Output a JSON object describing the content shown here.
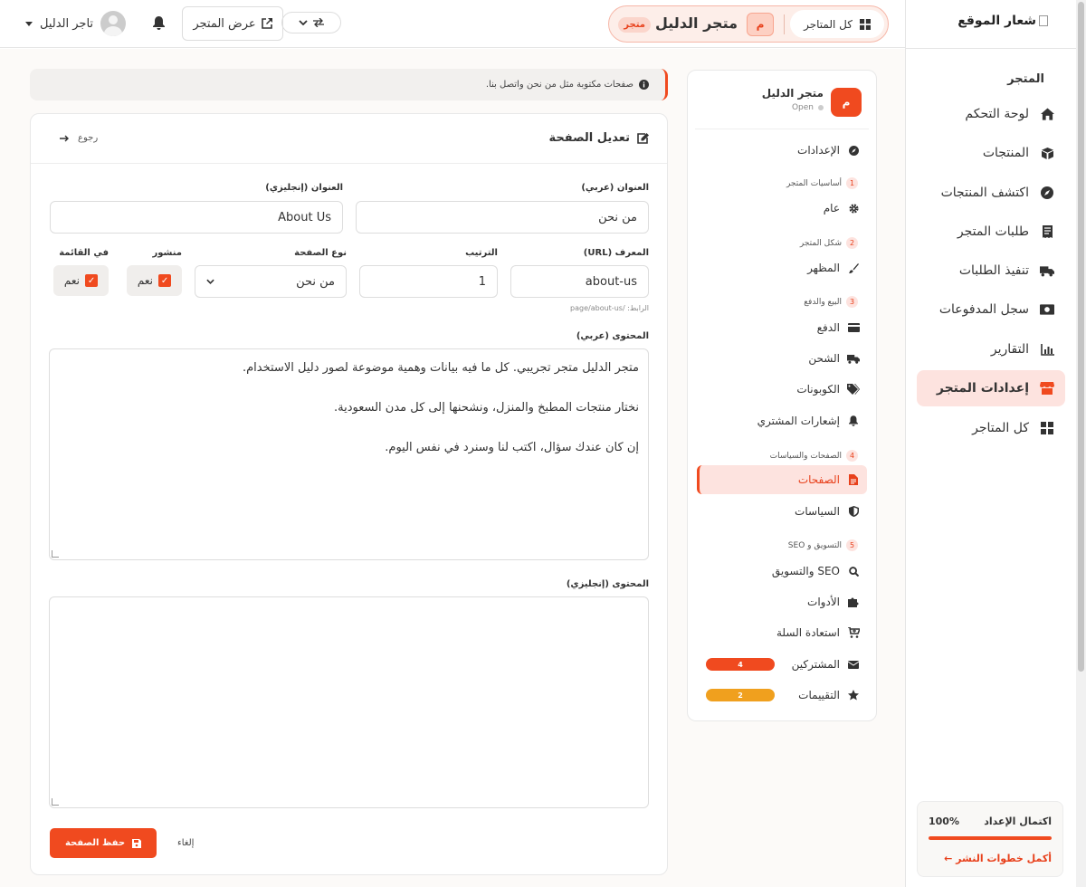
{
  "sidebar": {
    "logo_alt": "شعار الموقع",
    "section_title": "المتجر",
    "items": [
      {
        "label": "لوحة التحكم",
        "icon": "home-icon"
      },
      {
        "label": "المنتجات",
        "icon": "box-icon"
      },
      {
        "label": "اكتشف المنتجات",
        "icon": "compass-icon"
      },
      {
        "label": "طلبات المتجر",
        "icon": "receipt-icon"
      },
      {
        "label": "تنفيذ الطلبات",
        "icon": "truck-icon"
      },
      {
        "label": "سجل المدفوعات",
        "icon": "money-icon"
      },
      {
        "label": "التقارير",
        "icon": "chart-icon"
      },
      {
        "label": "إعدادات المتجر",
        "icon": "store-icon",
        "active": true
      },
      {
        "label": "كل المتاجر",
        "icon": "grid-icon"
      }
    ],
    "progress": {
      "title": "اكتمال الإعداد",
      "percent_label": "100%",
      "percent": 100,
      "link": "أكمل خطوات النشر ←"
    }
  },
  "topbar": {
    "all_stores": "كل المتاجر",
    "store_initial": "م",
    "store_name": "متجر الدليل",
    "store_badge": "متجر",
    "view_store": "عرض المتجر",
    "user_name": "تاجر الدليل"
  },
  "store_nav": {
    "initial": "م",
    "name": "متجر الدليل",
    "status": "Open",
    "settings": "الإعدادات",
    "groups": [
      {
        "num": "1",
        "title": "أساسيات المتجر"
      },
      {
        "num": "2",
        "title": "شكل المتجر"
      },
      {
        "num": "3",
        "title": "البيع والدفع"
      },
      {
        "num": "4",
        "title": "الصفحات والسياسات"
      },
      {
        "num": "5",
        "title": "التسويق و SEO"
      }
    ],
    "items": {
      "general": "عام",
      "appearance": "المظهر",
      "payment": "الدفع",
      "shipping": "الشحن",
      "coupons": "الكوبونات",
      "notifications": "إشعارات المشتري",
      "pages": "الصفحات",
      "policies": "السياسات",
      "seo": "SEO والتسويق",
      "tools": "الأدوات",
      "cart_recovery": "استعادة السلة",
      "subscribers": "المشتركين",
      "reviews": "التقييمات"
    },
    "subscribers_count": "4",
    "reviews_count": "2",
    "colors": {
      "subscribers_badge": "#f04a1f",
      "reviews_badge": "#f0a01e"
    }
  },
  "notice": "صفحات مكتوبة مثل من نحن واتصل بنا.",
  "editor": {
    "title": "تعديل الصفحة",
    "back": "رجوع",
    "title_ar_label": "العنوان (عربي)",
    "title_ar_value": "من نحن",
    "title_en_label": "العنوان (إنجليزي)",
    "title_en_value": "About Us",
    "slug_label": "المعرف (URL)",
    "slug_value": "about-us",
    "slug_hint": "الرابط: /page/about-us",
    "order_label": "الترتيب",
    "order_value": "1",
    "type_label": "نوع الصفحة",
    "type_value": "من نحن",
    "published_label": "منشور",
    "published_value": "نعم",
    "in_menu_label": "في القائمة",
    "in_menu_value": "نعم",
    "content_ar_label": "المحتوى (عربي)",
    "content_ar": [
      "متجر الدليل متجر تجريبي. كل ما فيه بيانات وهمية موضوعة لصور دليل الاستخدام.",
      "نختار منتجات المطبخ والمنزل، ونشحنها إلى كل مدن السعودية.",
      "إن كان عندك سؤال، اكتب لنا وسنرد في نفس اليوم."
    ],
    "content_en_label": "المحتوى (إنجليزي)",
    "content_en": "",
    "save": "حفظ الصفحة",
    "cancel": "إلغاء"
  },
  "colors": {
    "accent": "#f04a1f",
    "accent_light": "#fde3df"
  }
}
